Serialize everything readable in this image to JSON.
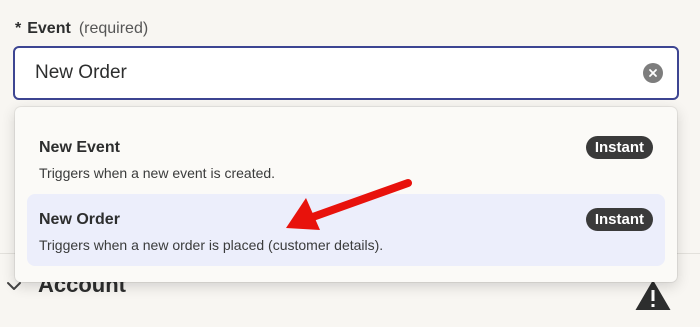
{
  "field": {
    "required_marker": "*",
    "label": "Event",
    "hint": "(required)",
    "value": "New Order"
  },
  "dropdown": {
    "options": [
      {
        "title": "New Event",
        "description": "Triggers when a new event is created.",
        "badge": "Instant",
        "selected": false
      },
      {
        "title": "New Order",
        "description": "Triggers when a new order is placed (customer details).",
        "badge": "Instant",
        "selected": true
      }
    ]
  },
  "background_section": {
    "title": "Account",
    "icons": [
      "chevron-down-icon",
      "warning-icon"
    ]
  },
  "colors": {
    "input_border": "#3d4592",
    "selected_option_bg": "#eceefb",
    "badge_bg": "#3a3a3a",
    "annotation_arrow": "#e8120c"
  }
}
